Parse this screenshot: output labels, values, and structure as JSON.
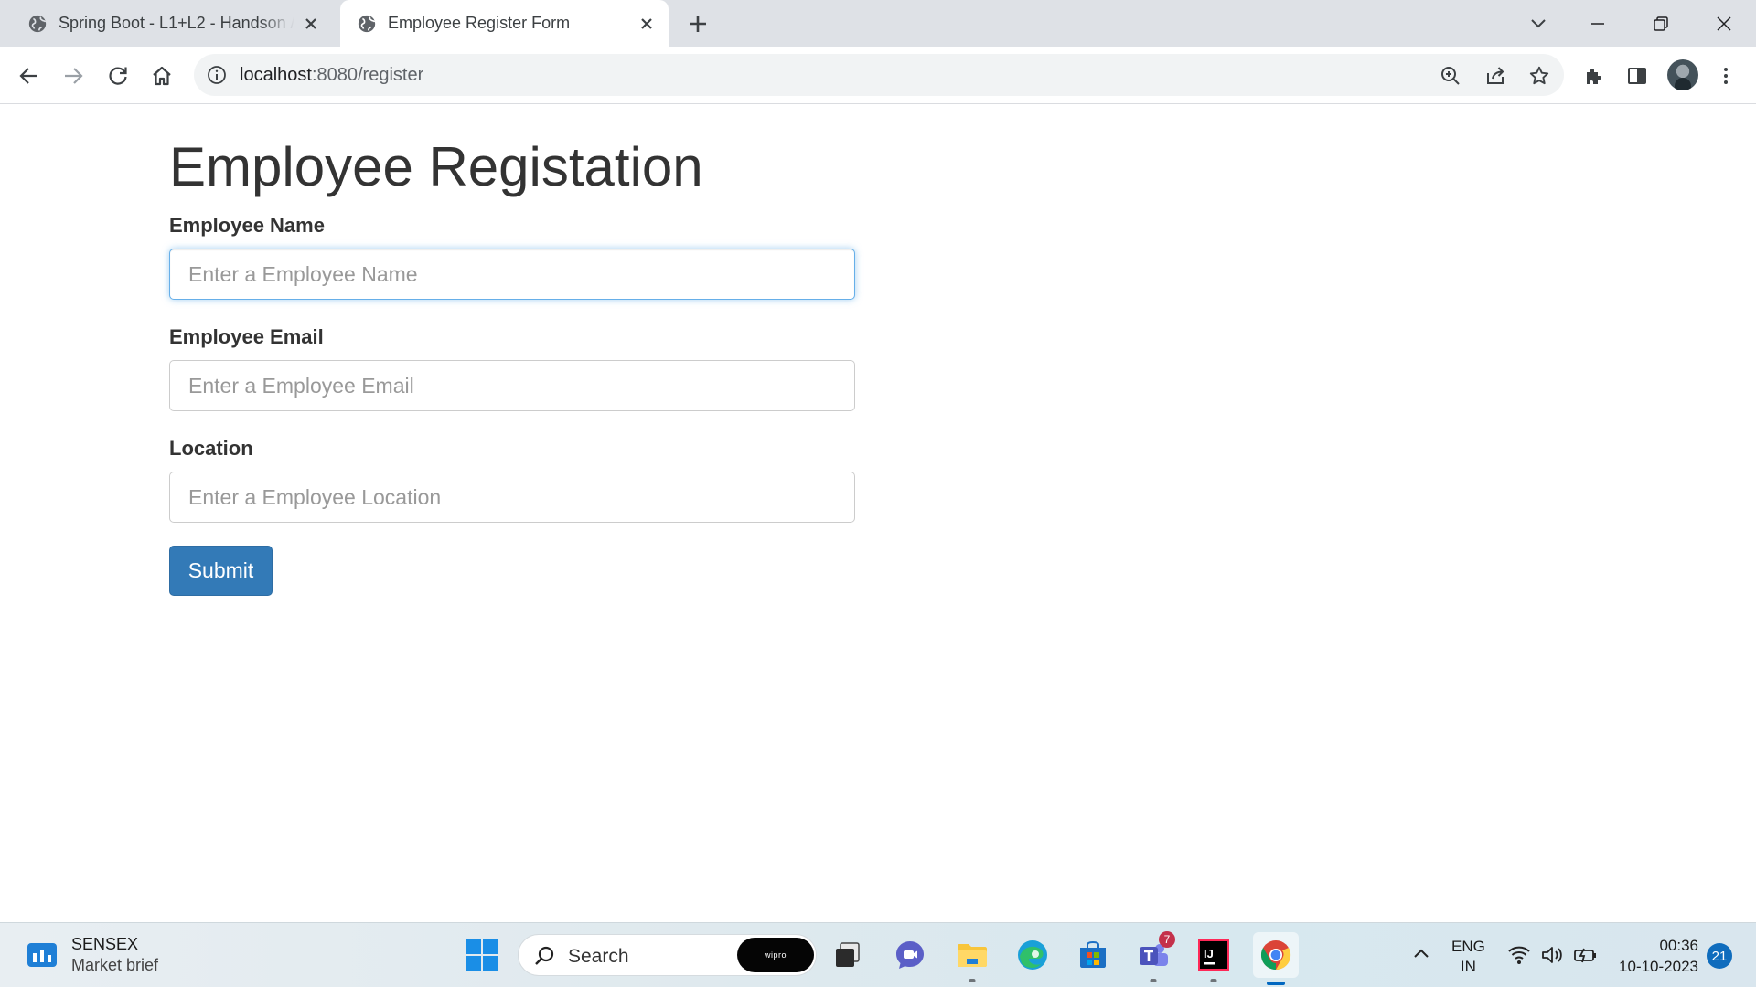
{
  "browser": {
    "tabs": [
      {
        "title": "Spring Boot - L1+L2 - Handson / Demo",
        "active": false
      },
      {
        "title": "Employee Register Form",
        "active": true
      }
    ],
    "url_host": "localhost",
    "url_path": ":8080/register"
  },
  "page": {
    "heading": "Employee Registation",
    "fields": [
      {
        "label": "Employee Name",
        "placeholder": "Enter a Employee Name",
        "value": "",
        "focused": true
      },
      {
        "label": "Employee Email",
        "placeholder": "Enter a Employee Email",
        "value": "",
        "focused": false
      },
      {
        "label": "Location",
        "placeholder": "Enter a Employee Location",
        "value": "",
        "focused": false
      }
    ],
    "submit_label": "Submit"
  },
  "taskbar": {
    "widget_title": "SENSEX",
    "widget_subtitle": "Market brief",
    "search_text": "Search",
    "search_badge": "wipro",
    "teams_badge": "7",
    "lang_line1": "ENG",
    "lang_line2": "IN",
    "time": "00:36",
    "date": "10-10-2023",
    "notification_count": "21",
    "apps": [
      "start-icon",
      "task-view-icon",
      "meet-icon",
      "file-explorer-icon",
      "edge-icon",
      "store-icon",
      "teams-icon",
      "intellij-icon",
      "chrome-icon"
    ]
  },
  "colors": {
    "primary_button": "#337ab7",
    "focus_border": "#66afe9",
    "tab_strip": "#dee1e6"
  }
}
